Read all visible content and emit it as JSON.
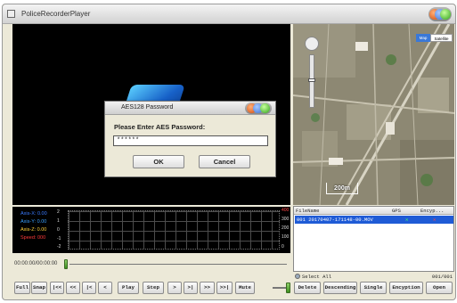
{
  "window": {
    "title": "PoliceRecorderPlayer"
  },
  "dialog": {
    "title": "AES128 Password",
    "prompt": "Please Enter AES Password:",
    "password_value": "******",
    "ok_label": "OK",
    "cancel_label": "Cancel"
  },
  "sensor": {
    "axis_x": "Axis-X: 0.00",
    "axis_y": "Axis-Y: 0.00",
    "axis_z": "Axis-Z: 0.00",
    "speed": "Speed: 000",
    "left_scale": [
      "2",
      "1",
      "0",
      "-1",
      "-2"
    ],
    "right_scale": [
      "400",
      "300",
      "200",
      "100",
      "0"
    ],
    "colors": {
      "x": "#3a7bff",
      "y": "#3aa0ff",
      "z": "#ffd23a",
      "speed": "#ff3a3a"
    }
  },
  "playback": {
    "time": "00:00:00/00:00:00",
    "buttons": [
      "Full",
      "Snap",
      "|<<",
      "<<",
      "|<",
      "<",
      "Play",
      "Step",
      ">",
      ">|",
      ">>",
      ">>|",
      "Mute"
    ]
  },
  "map": {
    "map_label": "Map",
    "satellite_label": "Satellite",
    "scale_label": "200m"
  },
  "filelist": {
    "columns": [
      "FileName",
      "GPS",
      "Encyp..."
    ],
    "rows": [
      {
        "name": "001  20170407-171148-00.MOV",
        "gps": "✕",
        "encrypted": "✕"
      }
    ]
  },
  "selection": {
    "select_all_label": "Select All",
    "count": "001/001"
  },
  "actions": {
    "buttons": [
      "Delete",
      "Descending",
      "Single",
      "Encyption",
      "Open"
    ]
  }
}
